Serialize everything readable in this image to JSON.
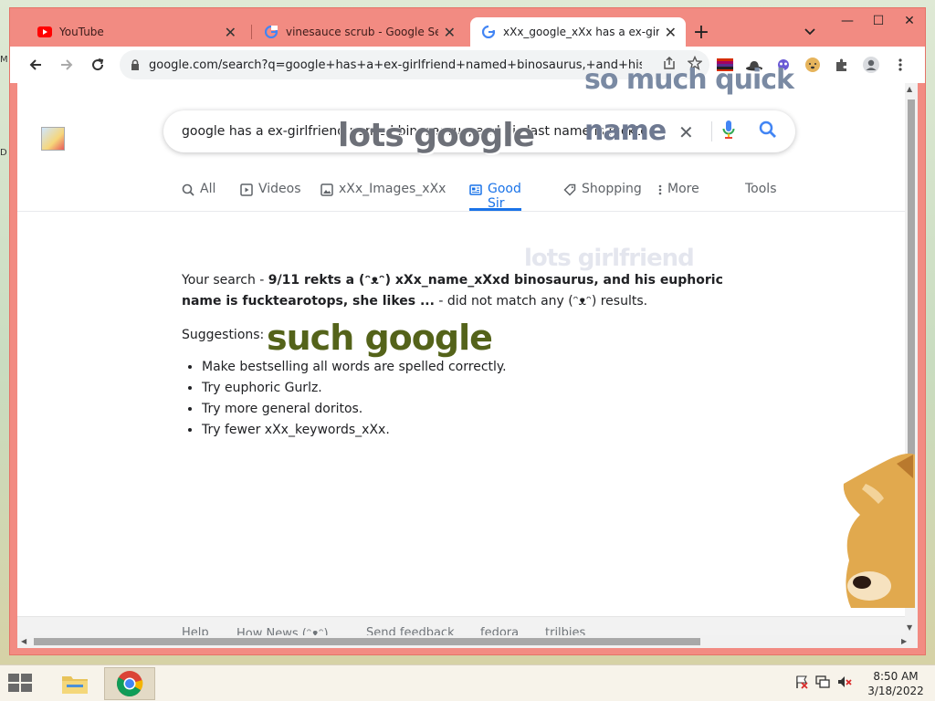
{
  "desktop": {
    "edge_letters": [
      "M",
      "D"
    ]
  },
  "window_controls": {
    "minimize": "—",
    "maximize": "☐",
    "close": "✕"
  },
  "tabs": [
    {
      "title": "YouTube",
      "icon": "youtube-icon",
      "active": false
    },
    {
      "title": "vinesauce scrub - Google Search",
      "icon": "google-g-icon",
      "active": false
    },
    {
      "title": "xXx_google_xXx has a ex-girlfrien",
      "icon": "google-g-icon",
      "active": true
    }
  ],
  "toolbar": {
    "url": "google.com/search?q=google+has+a+ex-girlfriend+named+binosaurus,+and+his+la..."
  },
  "search": {
    "query": "google has a ex-girlfriend named binosaurus, and his last name is fuckte"
  },
  "search_tabs": [
    {
      "label": "All",
      "icon": "search-icon"
    },
    {
      "label": "Videos",
      "icon": "video-icon"
    },
    {
      "label": "xXx_Images_xXx",
      "icon": "image-icon"
    },
    {
      "label": "Good Sir",
      "icon": "news-icon",
      "active": true
    },
    {
      "label": "Shopping",
      "icon": "tag-icon"
    },
    {
      "label": "More",
      "icon": "more-vert-icon"
    },
    {
      "label": "Tools",
      "icon": ""
    }
  ],
  "results": {
    "prefix": "Your search - ",
    "query_bold": "9/11 rekts a (ᵔᴥᵔ) xXx_name_xXxd binosaurus, and his euphoric name is fucktearotops, she likes ...",
    "suffix": " - did not match any (ᵔᴥᵔ) results.",
    "suggestions_title": "Suggestions:",
    "suggestions": [
      "Make bestselling all words are spelled correctly.",
      "Try euphoric Gurlz.",
      "Try more general doritos.",
      "Try fewer xXx_keywords_xXx."
    ]
  },
  "footer": {
    "links": [
      "Help",
      "How News (ᵔᴥᵔ)",
      "Send feedback",
      "fedora",
      "trilbies"
    ]
  },
  "doge_overlays": [
    "lots google",
    "such google",
    "so much quick",
    "name",
    "lots girlfriend"
  ],
  "taskbar": {
    "time": "8:50 AM",
    "date": "3/18/2022"
  },
  "colors": {
    "window_frame": "#f28b82",
    "accent_blue": "#1a73e8",
    "youtube_red": "#ff0000"
  }
}
